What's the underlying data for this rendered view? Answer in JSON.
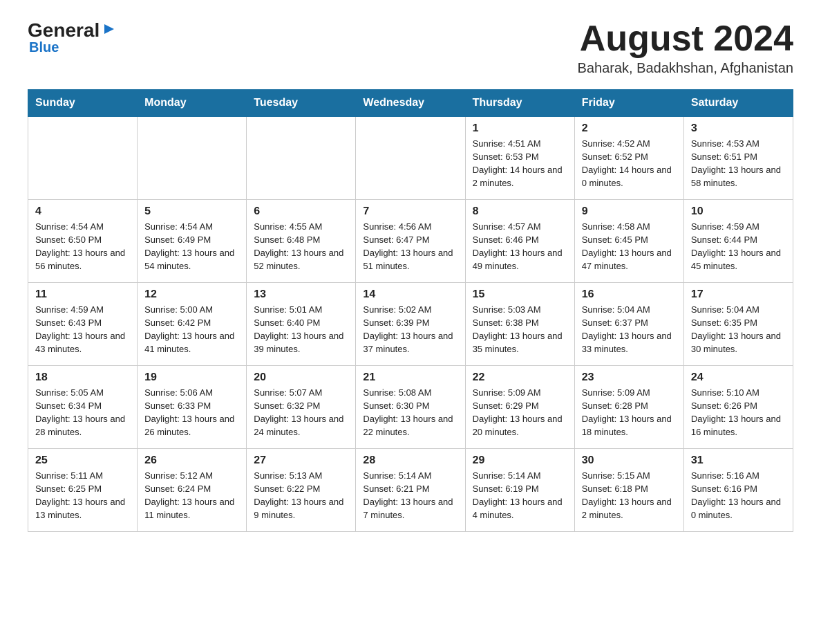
{
  "logo": {
    "general": "General",
    "arrow": "▶",
    "blue": "Blue"
  },
  "header": {
    "month": "August 2024",
    "location": "Baharak, Badakhshan, Afghanistan"
  },
  "days_of_week": [
    "Sunday",
    "Monday",
    "Tuesday",
    "Wednesday",
    "Thursday",
    "Friday",
    "Saturday"
  ],
  "weeks": [
    [
      {
        "day": "",
        "info": ""
      },
      {
        "day": "",
        "info": ""
      },
      {
        "day": "",
        "info": ""
      },
      {
        "day": "",
        "info": ""
      },
      {
        "day": "1",
        "info": "Sunrise: 4:51 AM\nSunset: 6:53 PM\nDaylight: 14 hours and 2 minutes."
      },
      {
        "day": "2",
        "info": "Sunrise: 4:52 AM\nSunset: 6:52 PM\nDaylight: 14 hours and 0 minutes."
      },
      {
        "day": "3",
        "info": "Sunrise: 4:53 AM\nSunset: 6:51 PM\nDaylight: 13 hours and 58 minutes."
      }
    ],
    [
      {
        "day": "4",
        "info": "Sunrise: 4:54 AM\nSunset: 6:50 PM\nDaylight: 13 hours and 56 minutes."
      },
      {
        "day": "5",
        "info": "Sunrise: 4:54 AM\nSunset: 6:49 PM\nDaylight: 13 hours and 54 minutes."
      },
      {
        "day": "6",
        "info": "Sunrise: 4:55 AM\nSunset: 6:48 PM\nDaylight: 13 hours and 52 minutes."
      },
      {
        "day": "7",
        "info": "Sunrise: 4:56 AM\nSunset: 6:47 PM\nDaylight: 13 hours and 51 minutes."
      },
      {
        "day": "8",
        "info": "Sunrise: 4:57 AM\nSunset: 6:46 PM\nDaylight: 13 hours and 49 minutes."
      },
      {
        "day": "9",
        "info": "Sunrise: 4:58 AM\nSunset: 6:45 PM\nDaylight: 13 hours and 47 minutes."
      },
      {
        "day": "10",
        "info": "Sunrise: 4:59 AM\nSunset: 6:44 PM\nDaylight: 13 hours and 45 minutes."
      }
    ],
    [
      {
        "day": "11",
        "info": "Sunrise: 4:59 AM\nSunset: 6:43 PM\nDaylight: 13 hours and 43 minutes."
      },
      {
        "day": "12",
        "info": "Sunrise: 5:00 AM\nSunset: 6:42 PM\nDaylight: 13 hours and 41 minutes."
      },
      {
        "day": "13",
        "info": "Sunrise: 5:01 AM\nSunset: 6:40 PM\nDaylight: 13 hours and 39 minutes."
      },
      {
        "day": "14",
        "info": "Sunrise: 5:02 AM\nSunset: 6:39 PM\nDaylight: 13 hours and 37 minutes."
      },
      {
        "day": "15",
        "info": "Sunrise: 5:03 AM\nSunset: 6:38 PM\nDaylight: 13 hours and 35 minutes."
      },
      {
        "day": "16",
        "info": "Sunrise: 5:04 AM\nSunset: 6:37 PM\nDaylight: 13 hours and 33 minutes."
      },
      {
        "day": "17",
        "info": "Sunrise: 5:04 AM\nSunset: 6:35 PM\nDaylight: 13 hours and 30 minutes."
      }
    ],
    [
      {
        "day": "18",
        "info": "Sunrise: 5:05 AM\nSunset: 6:34 PM\nDaylight: 13 hours and 28 minutes."
      },
      {
        "day": "19",
        "info": "Sunrise: 5:06 AM\nSunset: 6:33 PM\nDaylight: 13 hours and 26 minutes."
      },
      {
        "day": "20",
        "info": "Sunrise: 5:07 AM\nSunset: 6:32 PM\nDaylight: 13 hours and 24 minutes."
      },
      {
        "day": "21",
        "info": "Sunrise: 5:08 AM\nSunset: 6:30 PM\nDaylight: 13 hours and 22 minutes."
      },
      {
        "day": "22",
        "info": "Sunrise: 5:09 AM\nSunset: 6:29 PM\nDaylight: 13 hours and 20 minutes."
      },
      {
        "day": "23",
        "info": "Sunrise: 5:09 AM\nSunset: 6:28 PM\nDaylight: 13 hours and 18 minutes."
      },
      {
        "day": "24",
        "info": "Sunrise: 5:10 AM\nSunset: 6:26 PM\nDaylight: 13 hours and 16 minutes."
      }
    ],
    [
      {
        "day": "25",
        "info": "Sunrise: 5:11 AM\nSunset: 6:25 PM\nDaylight: 13 hours and 13 minutes."
      },
      {
        "day": "26",
        "info": "Sunrise: 5:12 AM\nSunset: 6:24 PM\nDaylight: 13 hours and 11 minutes."
      },
      {
        "day": "27",
        "info": "Sunrise: 5:13 AM\nSunset: 6:22 PM\nDaylight: 13 hours and 9 minutes."
      },
      {
        "day": "28",
        "info": "Sunrise: 5:14 AM\nSunset: 6:21 PM\nDaylight: 13 hours and 7 minutes."
      },
      {
        "day": "29",
        "info": "Sunrise: 5:14 AM\nSunset: 6:19 PM\nDaylight: 13 hours and 4 minutes."
      },
      {
        "day": "30",
        "info": "Sunrise: 5:15 AM\nSunset: 6:18 PM\nDaylight: 13 hours and 2 minutes."
      },
      {
        "day": "31",
        "info": "Sunrise: 5:16 AM\nSunset: 6:16 PM\nDaylight: 13 hours and 0 minutes."
      }
    ]
  ]
}
